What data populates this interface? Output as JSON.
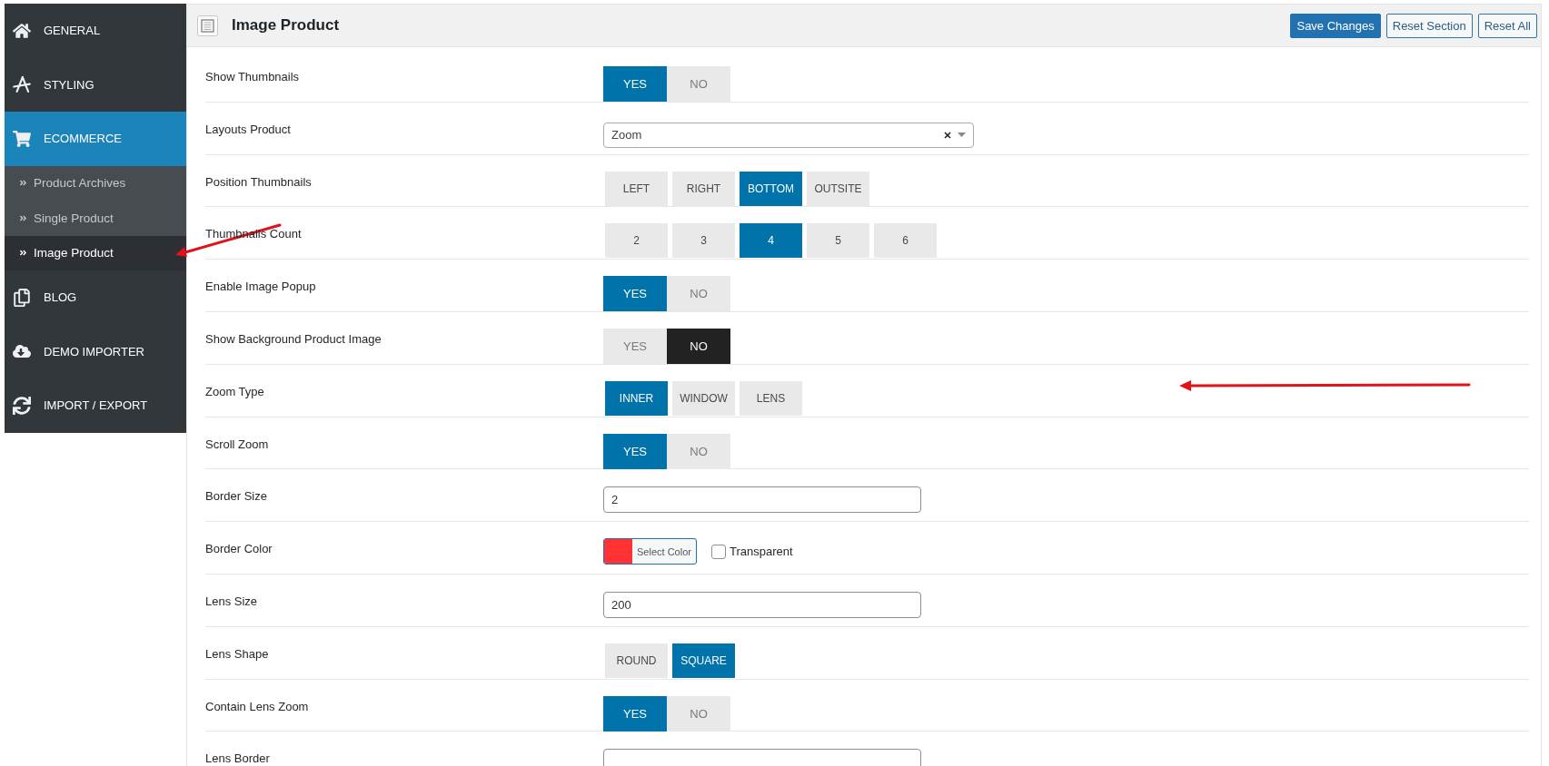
{
  "sidebar": {
    "items": [
      {
        "label": "GENERAL",
        "selected": false
      },
      {
        "label": "STYLING",
        "selected": false
      },
      {
        "label": "ECOMMERCE",
        "selected": true,
        "children": [
          {
            "label": "Product Archives",
            "selected": false
          },
          {
            "label": "Single Product",
            "selected": false
          },
          {
            "label": "Image Product",
            "selected": true
          }
        ]
      },
      {
        "label": "BLOG",
        "selected": false
      },
      {
        "label": "DEMO IMPORTER",
        "selected": false
      },
      {
        "label": "IMPORT / EXPORT",
        "selected": false
      }
    ]
  },
  "header": {
    "title": "Image Product",
    "buttons": [
      {
        "label": "Save Changes",
        "kind": "primary"
      },
      {
        "label": "Reset Section",
        "kind": "secondary"
      },
      {
        "label": "Reset All",
        "kind": "secondary"
      }
    ]
  },
  "rows": [
    {
      "label": "Show Thumbnails",
      "kind": "switch",
      "options": [
        {
          "label": "YES",
          "selected": true
        },
        {
          "label": "NO",
          "selected": false
        }
      ]
    },
    {
      "label": "Layouts Product",
      "kind": "select",
      "value": "Zoom"
    },
    {
      "label": "Position Thumbnails",
      "kind": "buttonset",
      "options": [
        {
          "label": "LEFT",
          "selected": false
        },
        {
          "label": "RIGHT",
          "selected": false
        },
        {
          "label": "BOTTOM",
          "selected": true
        },
        {
          "label": "OUTSITE",
          "selected": false
        }
      ]
    },
    {
      "label": "Thumbnails Count",
      "kind": "buttonset",
      "options": [
        {
          "label": "2",
          "selected": false
        },
        {
          "label": "3",
          "selected": false
        },
        {
          "label": "4",
          "selected": true
        },
        {
          "label": "5",
          "selected": false
        },
        {
          "label": "6",
          "selected": false
        }
      ]
    },
    {
      "label": "Enable Image Popup",
      "kind": "switch",
      "options": [
        {
          "label": "YES",
          "selected": true
        },
        {
          "label": "NO",
          "selected": false
        }
      ]
    },
    {
      "label": "Show Background Product Image",
      "kind": "switch",
      "options": [
        {
          "label": "YES",
          "selected": false,
          "hovered": false
        },
        {
          "label": "NO",
          "selected": true,
          "hovered": true
        }
      ]
    },
    {
      "label": "Zoom Type",
      "kind": "buttonset",
      "options": [
        {
          "label": "INNER",
          "selected": true
        },
        {
          "label": "WINDOW",
          "selected": false
        },
        {
          "label": "LENS",
          "selected": false
        }
      ]
    },
    {
      "label": "Scroll Zoom",
      "kind": "switch",
      "options": [
        {
          "label": "YES",
          "selected": true
        },
        {
          "label": "NO",
          "selected": false
        }
      ]
    },
    {
      "label": "Border Size",
      "kind": "text",
      "value": "2"
    },
    {
      "label": "Border Color",
      "kind": "color",
      "color": "#ff3333",
      "button": "Select Color",
      "checkbox": {
        "label": "Transparent",
        "checked": false
      }
    },
    {
      "label": "Lens Size",
      "kind": "text",
      "value": "200"
    },
    {
      "label": "Lens Shape",
      "kind": "buttonset",
      "options": [
        {
          "label": "ROUND",
          "selected": false
        },
        {
          "label": "SQUARE",
          "selected": true
        }
      ]
    },
    {
      "label": "Contain Lens Zoom",
      "kind": "switch",
      "options": [
        {
          "label": "YES",
          "selected": true
        },
        {
          "label": "NO",
          "selected": false
        }
      ]
    },
    {
      "label": "Lens Border",
      "kind": "text"
    }
  ]
}
